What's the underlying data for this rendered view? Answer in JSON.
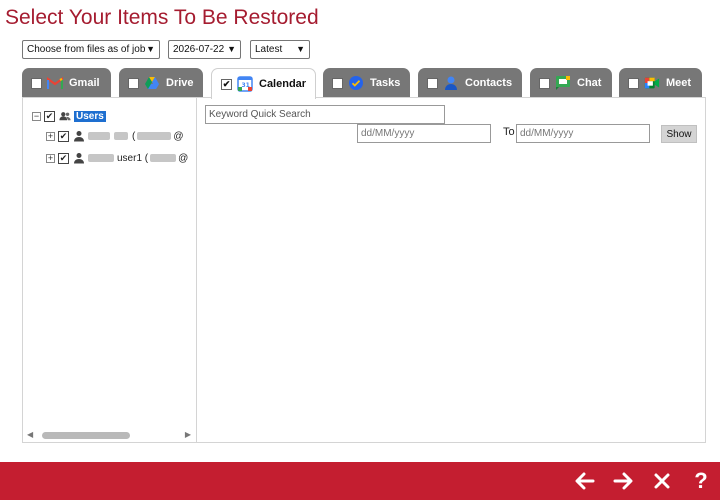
{
  "title": "Select Your Items To Be Restored",
  "filters": {
    "job_select": "Choose from files as of job",
    "date_select": "2026-07-22",
    "version_select": "Latest"
  },
  "tabs": [
    {
      "label": "Gmail",
      "checked": false,
      "icon": "gmail-icon"
    },
    {
      "label": "Drive",
      "checked": false,
      "icon": "drive-icon"
    },
    {
      "label": "Calendar",
      "checked": true,
      "icon": "calendar-icon",
      "active": true
    },
    {
      "label": "Tasks",
      "checked": false,
      "icon": "tasks-icon"
    },
    {
      "label": "Contacts",
      "checked": false,
      "icon": "contacts-icon"
    },
    {
      "label": "Chat",
      "checked": false,
      "icon": "chat-icon"
    },
    {
      "label": "Meet",
      "checked": false,
      "icon": "meet-icon"
    }
  ],
  "tree": {
    "root": {
      "label": "Users",
      "checked": true,
      "expanded": true
    },
    "children": [
      {
        "label_suffix": "(",
        "label_tail": "@",
        "checked": true
      },
      {
        "label_suffix": "user1 (",
        "label_tail": "@",
        "checked": true
      }
    ]
  },
  "search": {
    "keyword_placeholder": "Keyword Quick Search",
    "from_placeholder": "dd/MM/yyyy",
    "to_label": "To",
    "to_placeholder": "dd/MM/yyyy",
    "show_label": "Show"
  },
  "footer": {
    "help_label": "?"
  },
  "colors": {
    "brand": "#c41e30",
    "title": "#a51c30",
    "tab_inactive": "#777777",
    "selection": "#1e6fd0"
  }
}
